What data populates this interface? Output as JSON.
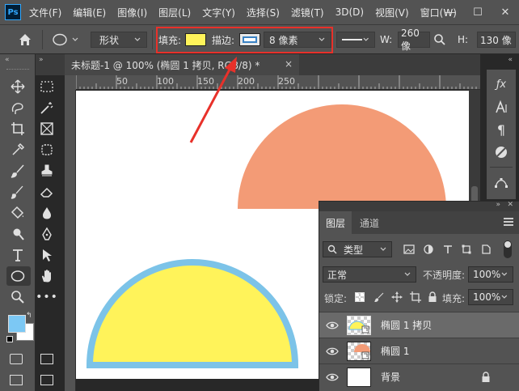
{
  "menu": {
    "logo": "Ps",
    "items": [
      "文件(F)",
      "编辑(E)",
      "图像(I)",
      "图层(L)",
      "文字(Y)",
      "选择(S)",
      "滤镜(T)",
      "3D(D)",
      "视图(V)",
      "窗口(W)"
    ],
    "window_controls": [
      "—",
      "☐",
      "✕"
    ]
  },
  "options": {
    "mode_label": "形状",
    "fill_label": "填充:",
    "fill_color": "#fff35a",
    "stroke_label": "描边:",
    "stroke_color": "#7cc3e8",
    "stroke_width": "8 像素",
    "width_label": "W:",
    "width_value": "260 像",
    "height_label": "H:",
    "height_value": "130 像"
  },
  "document": {
    "tab_title": "未标题-1 @ 100% (椭圆 1 拷贝, RGB/8) *",
    "close_glyph": "×",
    "ruler_labels": [
      "50",
      "100",
      "150",
      "200",
      "250"
    ]
  },
  "artwork": {
    "orange_color": "#f39b76",
    "yellow_color": "#fff35a",
    "stroke_color": "#7cc3e8"
  },
  "tools": {
    "foreground_color": "#7cc8f4",
    "background_color": "#ffffff"
  },
  "layers_panel": {
    "tab_layers": "图层",
    "tab_channels": "通道",
    "filter_label": "类型",
    "blend_mode": "正常",
    "opacity_label": "不透明度:",
    "opacity_value": "100%",
    "lock_label": "锁定:",
    "fill_label": "填充:",
    "fill_value": "100%",
    "layers": [
      {
        "name": "椭圆 1 拷贝",
        "selected": true
      },
      {
        "name": "椭圆 1",
        "selected": false
      },
      {
        "name": "背景",
        "selected": false
      }
    ]
  }
}
